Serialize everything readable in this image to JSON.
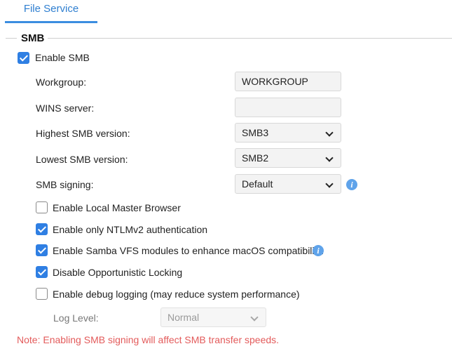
{
  "tabs": {
    "file_service": "File Service"
  },
  "section": {
    "title": "SMB"
  },
  "enable_smb": {
    "label": "Enable SMB",
    "checked": true
  },
  "settings": {
    "workgroup": {
      "label": "Workgroup:",
      "value": "WORKGROUP"
    },
    "wins_server": {
      "label": "WINS server:",
      "value": ""
    },
    "highest_version": {
      "label": "Highest SMB version:",
      "value": "SMB3"
    },
    "lowest_version": {
      "label": "Lowest SMB version:",
      "value": "SMB2"
    },
    "signing": {
      "label": "SMB signing:",
      "value": "Default"
    }
  },
  "options": {
    "local_master_browser": {
      "label": "Enable Local Master Browser",
      "checked": false
    },
    "ntlmv2": {
      "label": "Enable only NTLMv2 authentication",
      "checked": true
    },
    "samba_vfs": {
      "label": "Enable Samba VFS modules to enhance macOS compatibility.",
      "checked": true
    },
    "opportunistic_locking": {
      "label": "Disable Opportunistic Locking",
      "checked": true
    },
    "debug_logging": {
      "label": "Enable debug logging (may reduce system performance)",
      "checked": false
    }
  },
  "log_level": {
    "label": "Log Level:",
    "value": "Normal"
  },
  "note": "Note: Enabling SMB signing will affect SMB transfer speeds.",
  "colors": {
    "accent": "#2f7fe3",
    "note": "#e35b5b",
    "info": "#5fa3ea"
  },
  "icons": {
    "info": "info-icon",
    "dropdown": "chevron-down-icon",
    "check": "checkmark-icon"
  }
}
